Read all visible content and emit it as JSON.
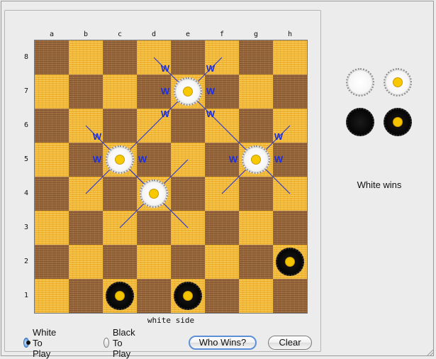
{
  "board": {
    "files": [
      "a",
      "b",
      "c",
      "d",
      "e",
      "f",
      "g",
      "h"
    ],
    "ranks": [
      "8",
      "7",
      "6",
      "5",
      "4",
      "3",
      "2",
      "1"
    ],
    "caption": "white side",
    "pieces": [
      {
        "square": "e7",
        "color": "white"
      },
      {
        "square": "c5",
        "color": "white"
      },
      {
        "square": "g5",
        "color": "white"
      },
      {
        "square": "d4",
        "color": "white"
      },
      {
        "square": "h2",
        "color": "black"
      },
      {
        "square": "c1",
        "color": "black"
      },
      {
        "square": "e1",
        "color": "black"
      }
    ],
    "move_markers": [
      {
        "square": "d8",
        "label": "W"
      },
      {
        "square": "f8",
        "label": "W"
      },
      {
        "square": "d7",
        "label": "W"
      },
      {
        "square": "f7",
        "label": "W"
      },
      {
        "square": "b6",
        "label": "W"
      },
      {
        "square": "d6",
        "label": "W"
      },
      {
        "square": "f6",
        "label": "W"
      },
      {
        "square": "h6",
        "label": "W"
      },
      {
        "square": "b5",
        "label": "W"
      },
      {
        "square": "d5",
        "label": "W"
      },
      {
        "square": "f5",
        "label": "W"
      },
      {
        "square": "h5",
        "label": "W"
      }
    ],
    "colors": {
      "light_square": "#f1b534",
      "dark_square": "#9a6a3e",
      "marker": "#1a2ee0",
      "piece_dot": "#f5c400"
    }
  },
  "controls": {
    "radio_white": {
      "label": "White To Play",
      "checked": true
    },
    "radio_black": {
      "label": "Black To Play",
      "checked": false
    },
    "who_wins_button": "Who Wins?",
    "clear_button": "Clear"
  },
  "palette": [
    {
      "piece": "white-man"
    },
    {
      "piece": "white-king"
    },
    {
      "piece": "black-man"
    },
    {
      "piece": "black-king"
    }
  ],
  "result": "White wins"
}
